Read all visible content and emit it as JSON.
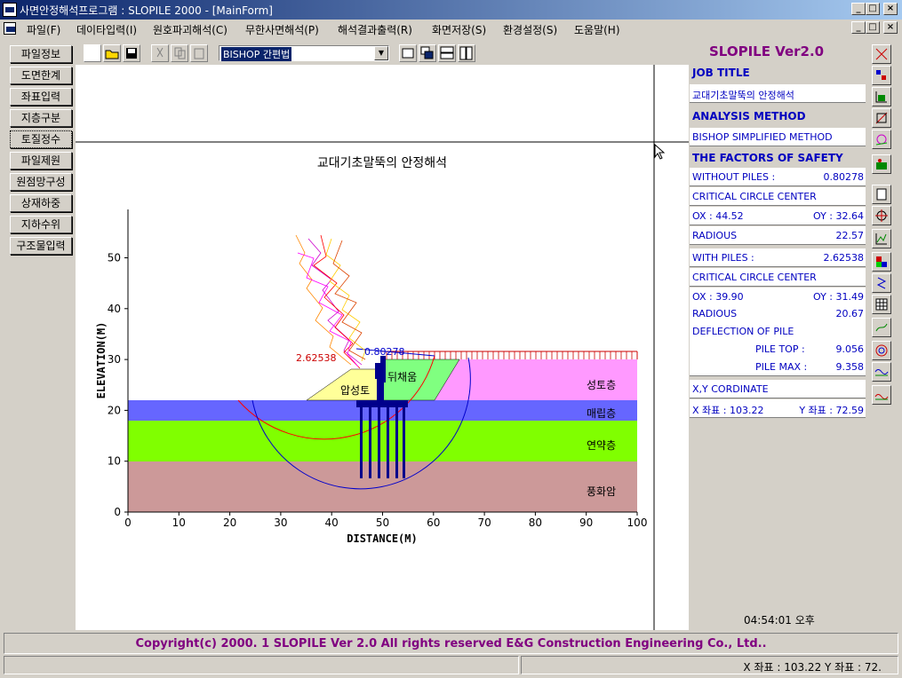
{
  "window": {
    "title": "사면안정해석프로그램 : SLOPILE 2000 - [MainForm]"
  },
  "menu": [
    "파일(F)",
    "데이타입력(I)",
    "원호파괴해석(C)",
    "무한사면해석(P)",
    "해석결과출력(R)",
    "화면저장(S)",
    "환경설정(S)",
    "도움말(H)"
  ],
  "left_buttons": [
    "파일정보",
    "도면한계",
    "좌표입력",
    "지층구분",
    "토질정수",
    "파일제원",
    "원점망구성",
    "상재하중",
    "지하수위",
    "구조물입력"
  ],
  "toolbar": {
    "method_select": "BISHOP 간편법"
  },
  "right": {
    "app_title": "SLOPILE Ver2.0",
    "job_title_head": "JOB TITLE",
    "job_title": "교대기초말뚝의 안정해석",
    "method_head": "ANALYSIS METHOD",
    "method": "BISHOP SIMPLIFIED METHOD",
    "fs_head": "THE FACTORS OF SAFETY",
    "without_label": "WITHOUT PILES :",
    "without_val": "0.80278",
    "ccc1": "CRITICAL CIRCLE CENTER",
    "ox1": "OX : 44.52",
    "oy1": "OY : 32.64",
    "rad1_label": "RADIOUS",
    "rad1": "22.57",
    "with_label": "WITH PILES :",
    "with_val": "2.62538",
    "ccc2": "CRITICAL CIRCLE CENTER",
    "ox2": "OX : 39.90",
    "oy2": "OY : 31.49",
    "rad2_label": "RADIOUS",
    "rad2": "20.67",
    "deflection": "DEFLECTION OF PILE",
    "piletop_label": "PILE TOP :",
    "piletop": "9.056",
    "pilemax_label": "PILE MAX :",
    "pilemax": "9.358",
    "xy_head": "X,Y CORDINATE",
    "x_coord": "X 좌표 : 103.22",
    "y_coord": "Y 좌표 : 72.59",
    "clock": "04:54:01 오후"
  },
  "plot": {
    "title": "교대기초말뚝의 안정해석",
    "xlabel": "DISTANCE(M)",
    "ylabel": "ELEVATION(M)",
    "x_ticks": [
      "0",
      "10",
      "20",
      "30",
      "40",
      "50",
      "60",
      "70",
      "80",
      "90",
      "100"
    ],
    "y_ticks": [
      "0",
      "10",
      "20",
      "30",
      "40",
      "50"
    ],
    "layers": [
      "성토층",
      "매립층",
      "연약층",
      "풍화암"
    ],
    "labels": {
      "backfill": "뒤채움",
      "pressure": "압성토"
    },
    "fs_with": "2.62538",
    "fs_without": "0.80278"
  },
  "status": {
    "copyright": "Copyright(c) 2000. 1 SLOPILE Ver 2.0 All rights reserved E&G Construction Engineering Co., Ltd..",
    "coords": "X 좌표 : 103.22 Y 좌표 : 72."
  }
}
